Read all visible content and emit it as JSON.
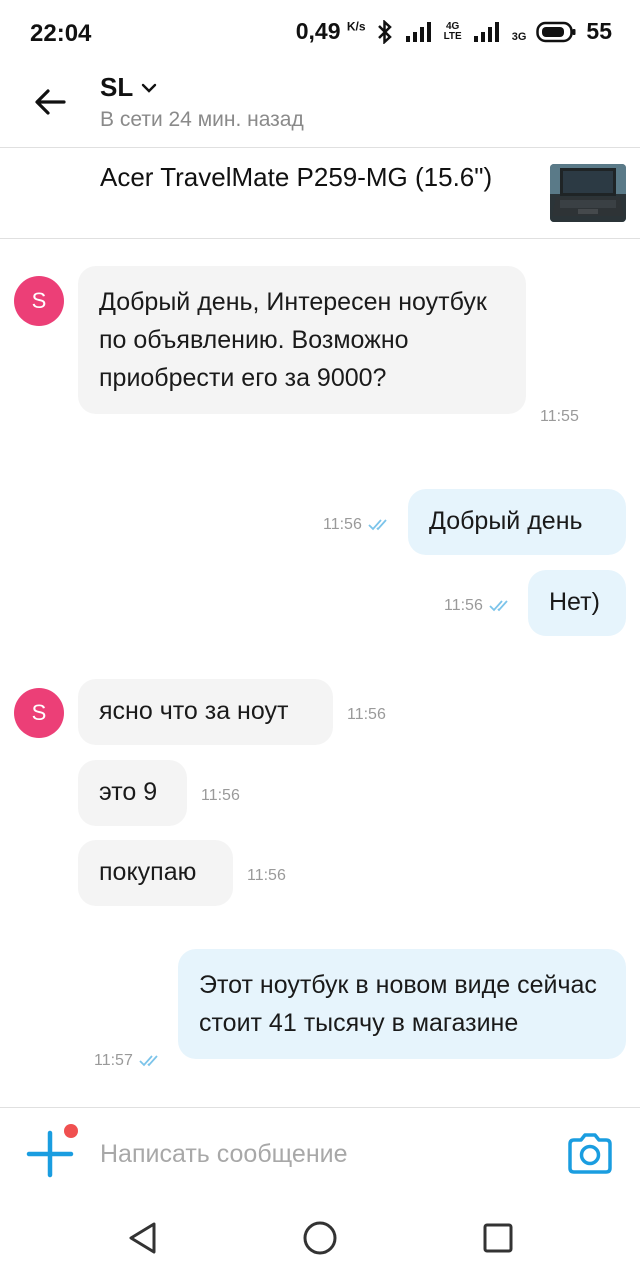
{
  "status_bar": {
    "time": "22:04",
    "network_speed": "0,49",
    "speed_unit": "K/s",
    "battery": "55",
    "net1": "4G",
    "net1_sub": "LTE",
    "net2": "3G"
  },
  "header": {
    "contact_name": "SL",
    "contact_status": "В сети 24 мин. назад"
  },
  "listing": {
    "title": "Acer TravelMate P259-MG (15.6\")"
  },
  "avatar_letter": "S",
  "messages": [
    {
      "direction": "incoming",
      "text": "Добрый день, Интересен ноутбук по объявлению. Возможно приобрести его за 9000?",
      "time": "11:55"
    },
    {
      "direction": "outgoing",
      "text": "Добрый день",
      "time": "11:56",
      "read": true
    },
    {
      "direction": "outgoing",
      "text": "Нет)",
      "time": "11:56",
      "read": true
    },
    {
      "direction": "incoming",
      "text": "ясно что за ноут",
      "time": "11:56"
    },
    {
      "direction": "incoming",
      "text": "это 9",
      "time": "11:56"
    },
    {
      "direction": "incoming",
      "text": "покупаю",
      "time": "11:56"
    },
    {
      "direction": "outgoing",
      "text": "Этот ноутбук в новом виде сейчас стоит 41 тысячу в магазине",
      "time": "11:57",
      "read": true
    }
  ],
  "compose": {
    "placeholder": "Написать сообщение"
  },
  "colors": {
    "accent": "#1a9de0",
    "avatar": "#ec3f77",
    "incoming_bubble": "#f4f4f4",
    "outgoing_bubble": "#e6f4fc",
    "badge_dot": "#f05050"
  },
  "icons": {
    "back": "arrow-left-icon",
    "dropdown": "chevron-down-icon",
    "add": "plus-icon",
    "camera": "camera-icon",
    "read_receipt": "double-check-icon",
    "nav_back": "triangle-back-icon",
    "nav_home": "circle-home-icon",
    "nav_recents": "square-recents-icon"
  }
}
